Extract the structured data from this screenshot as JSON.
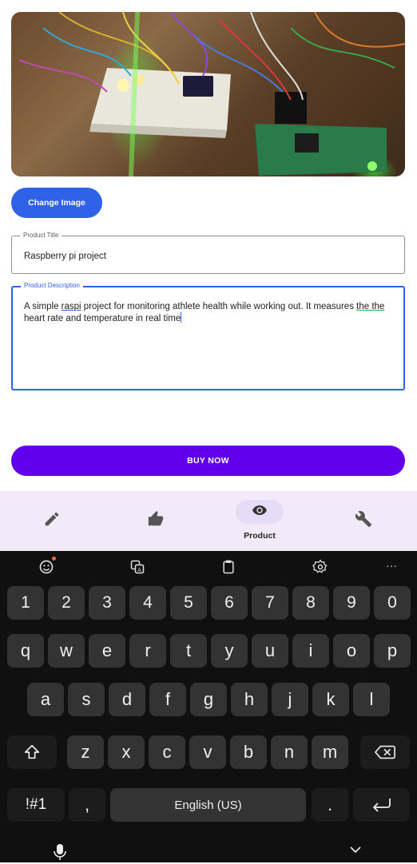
{
  "image_button": {
    "label": "Change Image"
  },
  "title_field": {
    "legend": "Product Title",
    "value": "Raspberry pi project"
  },
  "description_field": {
    "legend": "Product Description",
    "text_before_spell": "A simple ",
    "spell_word": "raspi",
    "text_mid": " project for monitoring athlete health while working out. It measures ",
    "gram_words": "the the",
    "text_after": " heart rate and temperature in real time"
  },
  "buy_button": {
    "label": "BUY NOW"
  },
  "bottom_nav": {
    "items": [
      {
        "icon": "pencil-icon",
        "label": ""
      },
      {
        "icon": "thumbs-up-icon",
        "label": ""
      },
      {
        "icon": "eye-icon",
        "label": "Product",
        "active": true
      },
      {
        "icon": "wrench-icon",
        "label": ""
      }
    ]
  },
  "keyboard": {
    "toolbar": [
      "emoji-icon",
      "translate-icon",
      "clipboard-icon",
      "settings-icon",
      "more-icon"
    ],
    "more_label": "···",
    "row_numbers": [
      "1",
      "2",
      "3",
      "4",
      "5",
      "6",
      "7",
      "8",
      "9",
      "0"
    ],
    "row1": [
      "q",
      "w",
      "e",
      "r",
      "t",
      "y",
      "u",
      "i",
      "o",
      "p"
    ],
    "row2": [
      "a",
      "s",
      "d",
      "f",
      "g",
      "h",
      "j",
      "k",
      "l"
    ],
    "row3": [
      "z",
      "x",
      "c",
      "v",
      "b",
      "n",
      "m"
    ],
    "symbols_label": "!#1",
    "comma_label": ",",
    "space_label": "English (US)",
    "period_label": "."
  },
  "colors": {
    "accent_blue": "#2f62e8",
    "buy_purple": "#6200ee",
    "nav_bg": "#f2eaf8",
    "keyboard_bg": "#101010",
    "key_bg": "#333333"
  }
}
